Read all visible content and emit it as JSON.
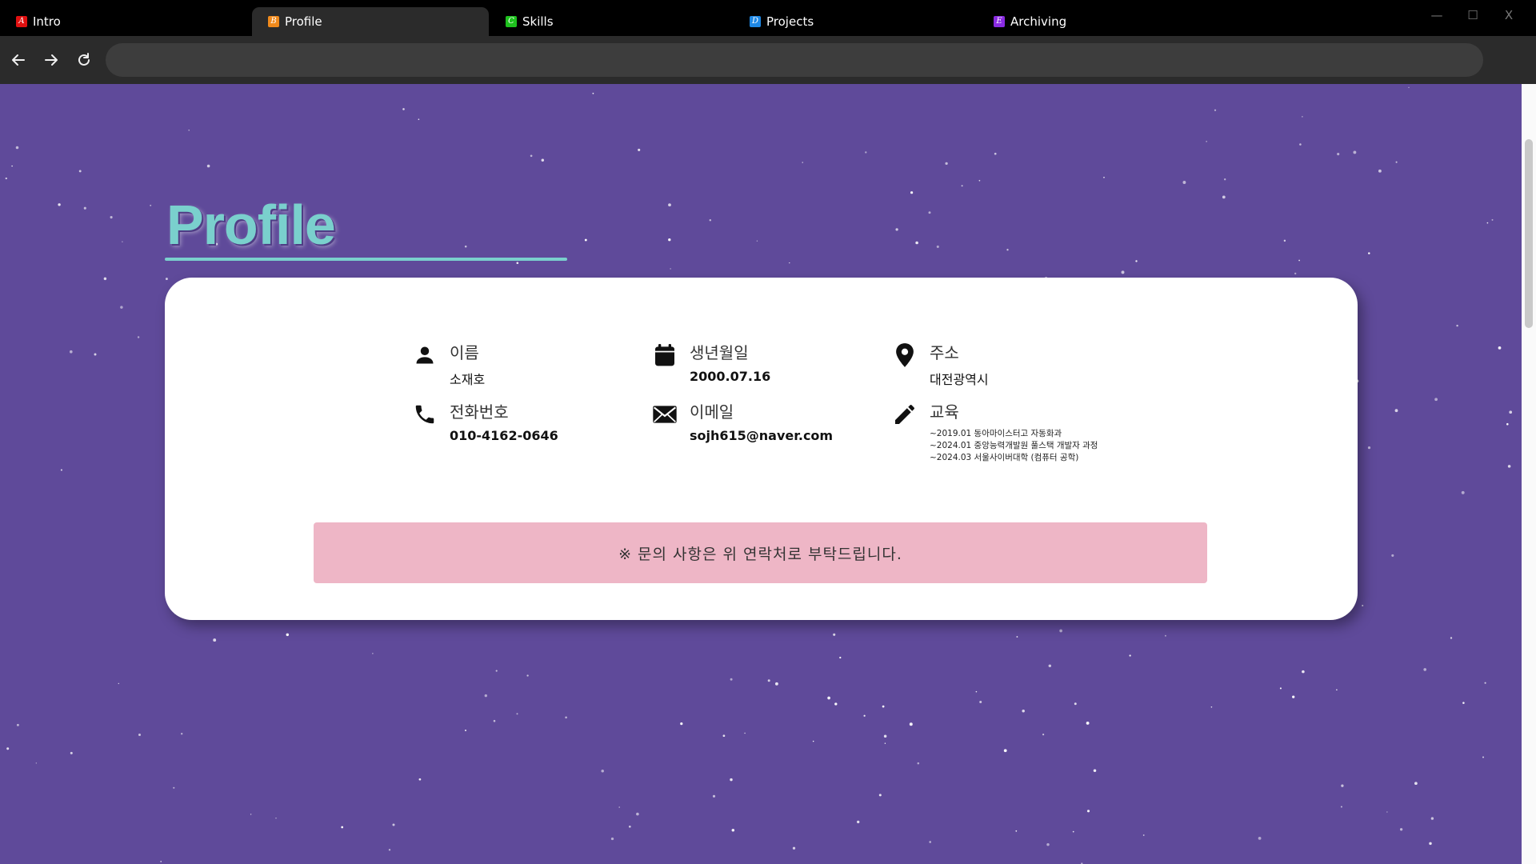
{
  "browser": {
    "tabs": [
      {
        "label": "Intro",
        "favicon_letter": "A",
        "favicon_color": "#e01010",
        "active": false
      },
      {
        "label": "Profile",
        "favicon_letter": "B",
        "favicon_color": "#f08a1c",
        "active": true
      },
      {
        "label": "Skills",
        "favicon_letter": "C",
        "favicon_color": "#1ec21e",
        "active": false
      },
      {
        "label": "Projects",
        "favicon_letter": "D",
        "favicon_color": "#1e88e5",
        "active": false
      },
      {
        "label": "Archiving",
        "favicon_letter": "E",
        "favicon_color": "#8a2be2",
        "active": false
      }
    ],
    "window_controls": {
      "minimize": "—",
      "maximize": "☐",
      "close": "X"
    },
    "address_value": ""
  },
  "page": {
    "title": "Profile",
    "colors": {
      "background": "#5f4a9a",
      "accent": "#7ad0cd",
      "notice_bg": "#eeb6c6"
    },
    "info": {
      "name": {
        "label": "이름",
        "value": "소재호",
        "icon": "person-icon"
      },
      "birth": {
        "label": "생년월일",
        "value": "2000.07.16",
        "icon": "calendar-icon"
      },
      "address": {
        "label": "주소",
        "value": "대전광역시",
        "icon": "map-pin-icon"
      },
      "phone": {
        "label": "전화번호",
        "value": "010-4162-0646",
        "icon": "phone-icon"
      },
      "email": {
        "label": "이메일",
        "value": "sojh615@naver.com",
        "icon": "mail-icon"
      },
      "education": {
        "label": "교육",
        "icon": "pencil-icon",
        "items": [
          "~2019.01 동아마이스터고 자동화과",
          "~2024.01 중앙능력개발원 풀스택 개발자 과정",
          "~2024.03 서울사이버대학 (컴퓨터 공학)"
        ]
      }
    },
    "notice": "※ 문의 사항은 위 연락처로 부탁드립니다."
  }
}
